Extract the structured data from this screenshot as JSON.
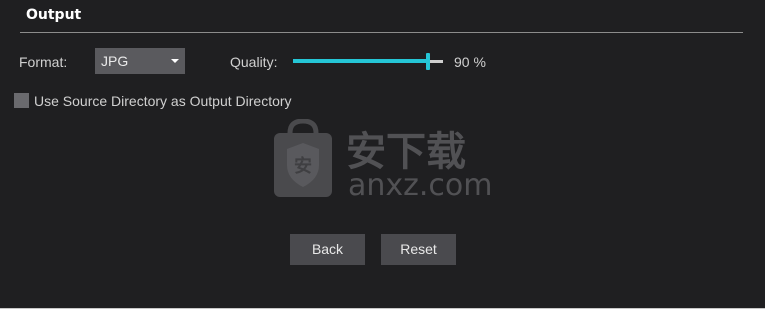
{
  "section": {
    "title": "Output"
  },
  "format": {
    "label": "Format:",
    "selected": "JPG"
  },
  "quality": {
    "label": "Quality:",
    "value_text": "90 %",
    "level": 0.9
  },
  "options": {
    "use_source_dir_label": "Use Source Directory as Output Directory",
    "use_source_dir_checked": false
  },
  "buttons": {
    "back": "Back",
    "reset": "Reset"
  },
  "watermark": {
    "text_cn": "安下载",
    "text_url": "anxz.com",
    "badge_char": "安"
  },
  "colors": {
    "background": "#1f1f21",
    "accent": "#25c6d6",
    "button": "#4a4a4e",
    "select": "#5a5a5e"
  }
}
